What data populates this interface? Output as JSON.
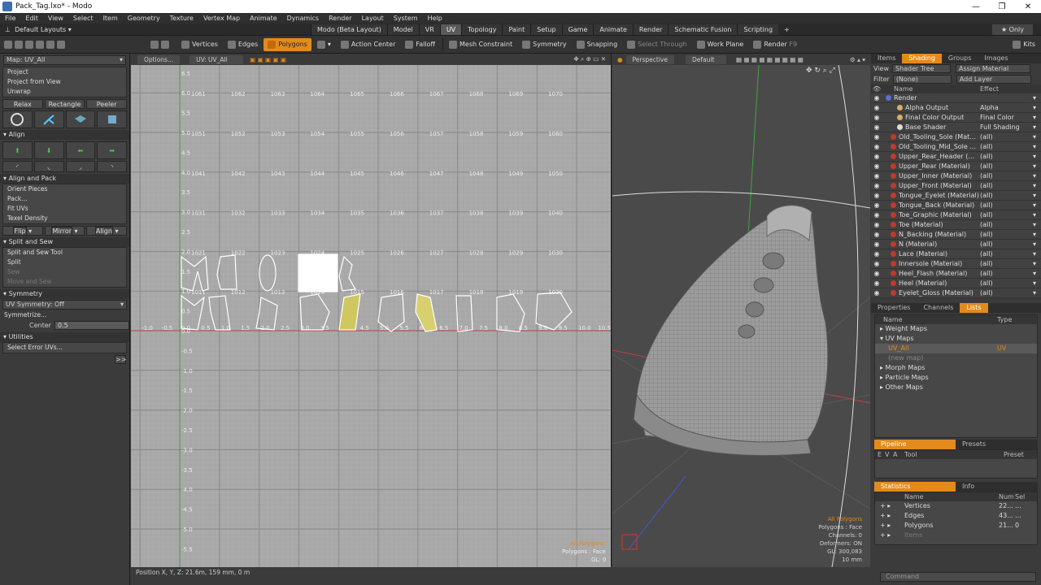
{
  "window": {
    "title": "Pack_Tag.lxo* - Modo",
    "controls": [
      "—",
      "❐",
      "✕"
    ]
  },
  "menu": [
    "File",
    "Edit",
    "View",
    "Select",
    "Item",
    "Geometry",
    "Texture",
    "Vertex Map",
    "Animate",
    "Dynamics",
    "Render",
    "Layout",
    "System",
    "Help"
  ],
  "layout": {
    "name": "Default Layouts",
    "tabs": [
      "Modo (Beta Layout)",
      "Model",
      "VR",
      "UV",
      "Topology",
      "Paint",
      "Setup",
      "Game",
      "Animate",
      "Render",
      "Schematic Fusion",
      "Scripting"
    ],
    "active_tab": "UV",
    "plus": "+",
    "only": "★ Only"
  },
  "toolbar": {
    "vertices": "Vertices",
    "edges": "Edges",
    "polygons": "Polygons",
    "action_center": "Action Center",
    "falloff": "Falloff",
    "mesh_constraint": "Mesh Constraint",
    "symmetry": "Symmetry",
    "snapping": "Snapping",
    "select_through": "Select Through",
    "work_plane": "Work Plane",
    "render": "Render",
    "render_key": "F9",
    "kits": "Kits"
  },
  "left": {
    "map": "Map: UV_All",
    "proj": [
      "Project",
      "Project from View",
      "Unwrap"
    ],
    "relax": [
      "Relax",
      "Rectangle",
      "Peeler"
    ],
    "align": "Align",
    "align_pack": "Align and Pack",
    "pack": [
      "Orient Pieces",
      "Pack...",
      "Fit UVs",
      "Texel Density"
    ],
    "flip": [
      "Flip",
      "Mirror",
      "Align"
    ],
    "split_sew": "Split and Sew",
    "split": [
      "Split and Sew Tool",
      "Split",
      "Sew",
      "Move and Sew"
    ],
    "symmetry": "Symmetry",
    "uv_sym": "UV Symmetry: Off",
    "symmetrize": "Symmetrize...",
    "center_label": "Center",
    "center_val": "0.5",
    "utilities": "Utilities",
    "select_err": "Select Error UVs...",
    "expand": ">>"
  },
  "uv": {
    "options": "Options...",
    "map": "UV: UV_All",
    "ylabels": [
      "6.5",
      "6.0",
      "5.5",
      "5.0",
      "4.5",
      "4.0",
      "3.5",
      "3.0",
      "2.5",
      "2.0",
      "1.5",
      "1.0",
      "0.5",
      "0.0",
      "-0.5",
      "-1.0",
      "-1.5",
      "-2.0",
      "-2.5",
      "-3.0",
      "-3.5",
      "-4.0",
      "-4.5",
      "-5.0",
      "-5.5"
    ],
    "xlabels": [
      "-1.0",
      "-0.5",
      "0.0",
      "0.5",
      "1.0",
      "1.5",
      "2.0",
      "2.5",
      "3.0",
      "3.5",
      "4.0",
      "4.5",
      "5.0",
      "5.5",
      "6.0",
      "6.5",
      "7.0",
      "7.5",
      "8.0",
      "8.5",
      "9.0",
      "9.5",
      "10.0",
      "10.5"
    ],
    "udim_rows": [
      [
        "1061",
        "1062",
        "1063",
        "1064",
        "1065",
        "1066",
        "1067",
        "1068",
        "1069",
        "1070"
      ],
      [
        "1051",
        "1052",
        "1053",
        "1054",
        "1055",
        "1056",
        "1057",
        "1058",
        "1059",
        "1060"
      ],
      [
        "1041",
        "1042",
        "1043",
        "1044",
        "1045",
        "1046",
        "1047",
        "1048",
        "1049",
        "1050"
      ],
      [
        "1031",
        "1032",
        "1033",
        "1034",
        "1035",
        "1036",
        "1037",
        "1038",
        "1039",
        "1040"
      ],
      [
        "1021",
        "1022",
        "1023",
        "1024",
        "1025",
        "1026",
        "1027",
        "1028",
        "1029",
        "1030"
      ],
      [
        "1011",
        "1012",
        "1013",
        "1014",
        "1015",
        "1016",
        "1017",
        "1018",
        "1019",
        "1020"
      ]
    ],
    "info1": "All Polygons",
    "info2": "Polygons : Face",
    "info3": "GL: 0"
  },
  "persp": {
    "mode": "Perspective",
    "shade": "Default",
    "info": [
      "All Polygons",
      "Polygons : Face",
      "Channels: 0",
      "Deformers: ON",
      "GL: 300,083",
      "10 mm"
    ]
  },
  "status": "Position X, Y, Z:  21.6m, 159 mm, 0 m",
  "right": {
    "tabs": [
      "Items",
      "Shading",
      "Groups",
      "Images"
    ],
    "active": "Shading",
    "view_label": "View",
    "view_val": "Shader Tree",
    "assign": "Assign Material",
    "filter_label": "Filter",
    "filter_val": "(None)",
    "addlayer": "Add Layer",
    "col_name": "Name",
    "col_effect": "Effect",
    "rows": [
      {
        "n": "Render",
        "e": "",
        "c": "#5a6fd0"
      },
      {
        "n": "Alpha Output",
        "e": "Alpha",
        "c": "#d8b060"
      },
      {
        "n": "Final Color Output",
        "e": "Final Color",
        "c": "#d8b060"
      },
      {
        "n": "Base Shader",
        "e": "Full Shading",
        "c": "#dddddd"
      },
      {
        "n": "Old_Tooling_Sole (Mat...",
        "e": "(all)",
        "c": "#c03a2b"
      },
      {
        "n": "Old_Tooling_Mid_Sole ...",
        "e": "(all)",
        "c": "#c03a2b"
      },
      {
        "n": "Upper_Rear_Header (...",
        "e": "(all)",
        "c": "#c03a2b"
      },
      {
        "n": "Upper_Rear (Material)",
        "e": "(all)",
        "c": "#c03a2b"
      },
      {
        "n": "Upper_Inner (Material)",
        "e": "(all)",
        "c": "#c03a2b"
      },
      {
        "n": "Upper_Front (Material)",
        "e": "(all)",
        "c": "#c03a2b"
      },
      {
        "n": "Tongue_Eyelet (Material)",
        "e": "(all)",
        "c": "#c03a2b"
      },
      {
        "n": "Tongue_Back (Material)",
        "e": "(all)",
        "c": "#c03a2b"
      },
      {
        "n": "Toe_Graphic (Material)",
        "e": "(all)",
        "c": "#c03a2b"
      },
      {
        "n": "Toe (Material)",
        "e": "(all)",
        "c": "#c03a2b"
      },
      {
        "n": "N_Backing (Material)",
        "e": "(all)",
        "c": "#c03a2b"
      },
      {
        "n": "N (Material)",
        "e": "(all)",
        "c": "#c03a2b"
      },
      {
        "n": "Lace (Material)",
        "e": "(all)",
        "c": "#c03a2b"
      },
      {
        "n": "Innersole (Material)",
        "e": "(all)",
        "c": "#c03a2b"
      },
      {
        "n": "Heel_Flash (Material)",
        "e": "(all)",
        "c": "#c03a2b"
      },
      {
        "n": "Heel (Material)",
        "e": "(all)",
        "c": "#c03a2b"
      },
      {
        "n": "Eyelet_Gloss (Material)",
        "e": "(all)",
        "c": "#c03a2b"
      }
    ],
    "tabs2": [
      "Properties",
      "Channels",
      "Lists"
    ],
    "active2": "Lists",
    "list_name": "Name",
    "list_type": "Type",
    "list": [
      {
        "n": "▸ Weight Maps",
        "t": ""
      },
      {
        "n": "▾ UV Maps",
        "t": ""
      },
      {
        "n": "    UV_All",
        "t": "UV"
      },
      {
        "n": "    (new map)",
        "t": ""
      },
      {
        "n": "▸ Morph Maps",
        "t": ""
      },
      {
        "n": "▸ Particle Maps",
        "t": ""
      },
      {
        "n": "▸ Other Maps",
        "t": ""
      }
    ],
    "pipeline": "Pipeline",
    "presets": "Presets",
    "pipe_cols": [
      "E",
      "V",
      "A",
      "Tool",
      "Preset"
    ],
    "stats": "Statistics",
    "info": "Info",
    "stat_cols": [
      "Name",
      "Num",
      "Sel"
    ],
    "stat_rows": [
      {
        "n": "Vertices",
        "num": "22...",
        "sel": "..."
      },
      {
        "n": "Edges",
        "num": "43...",
        "sel": "..."
      },
      {
        "n": "Polygons",
        "num": "21...",
        "sel": "0"
      },
      {
        "n": "Items",
        "num": "",
        "sel": ""
      }
    ],
    "command": "Command"
  }
}
